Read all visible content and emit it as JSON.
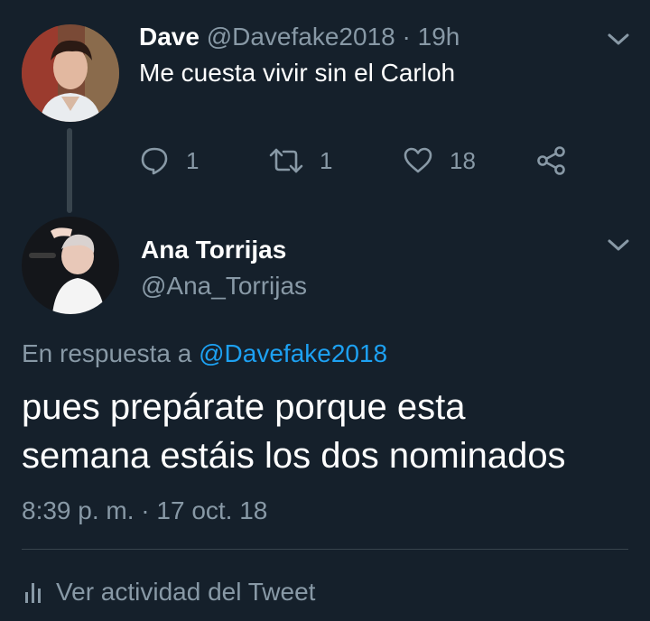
{
  "parent_tweet": {
    "author_name": "Dave",
    "author_handle": "@Davefake2018",
    "separator": "·",
    "time_ago": "19h",
    "text": "Me cuesta vivir sin el Carloh",
    "reply_count": "1",
    "retweet_count": "1",
    "like_count": "18",
    "icons": [
      "reply-icon",
      "retweet-icon",
      "like-icon",
      "share-icon",
      "chevron-down-icon"
    ]
  },
  "reply_tweet": {
    "author_name": "Ana Torrijas",
    "author_handle": "@Ana_Torrijas",
    "reply_to_prefix": "En respuesta a",
    "reply_to_handle": "@Davefake2018",
    "text_line1": "pues prepárate porque esta",
    "text_line2": "semana estáis los dos nominados",
    "timestamp": "8:39 p. m. · 17 oct. 18"
  },
  "footer": {
    "activity_label": "Ver actividad del Tweet",
    "icon": "activity-bars-icon"
  },
  "colors": {
    "background": "#15202b",
    "primary_text": "#ffffff",
    "secondary_text": "#8899a6",
    "accent": "#1da1f2",
    "divider": "#38444d"
  }
}
